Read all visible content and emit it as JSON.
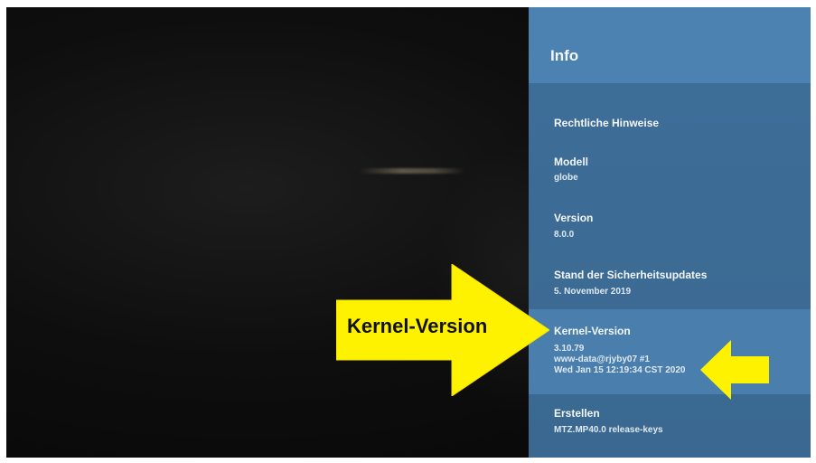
{
  "panel": {
    "title": "Info",
    "items": [
      {
        "label": "Rechtliche Hinweise",
        "values": []
      },
      {
        "label": "Modell",
        "values": [
          "globe"
        ]
      },
      {
        "label": "Version",
        "values": [
          "8.0.0"
        ]
      },
      {
        "label": "Stand der Sicherheitsupdates",
        "values": [
          "5. November 2019"
        ]
      },
      {
        "label": "Kernel-Version",
        "values": [
          "3.10.79",
          "www-data@rjyby07 #1",
          "Wed Jan 15 12:19:34 CST 2020"
        ]
      },
      {
        "label": "Erstellen",
        "values": [
          "MTZ.MP40.0 release-keys"
        ]
      }
    ]
  },
  "annotation": {
    "arrow_label": "Kernel-Version",
    "arrow_color": "#fff200"
  },
  "colors": {
    "panel_background": "#3e6f9a",
    "panel_header": "#4c82b1",
    "highlight_row": "#4a7fad",
    "screen_background": "#0e0e0e"
  }
}
